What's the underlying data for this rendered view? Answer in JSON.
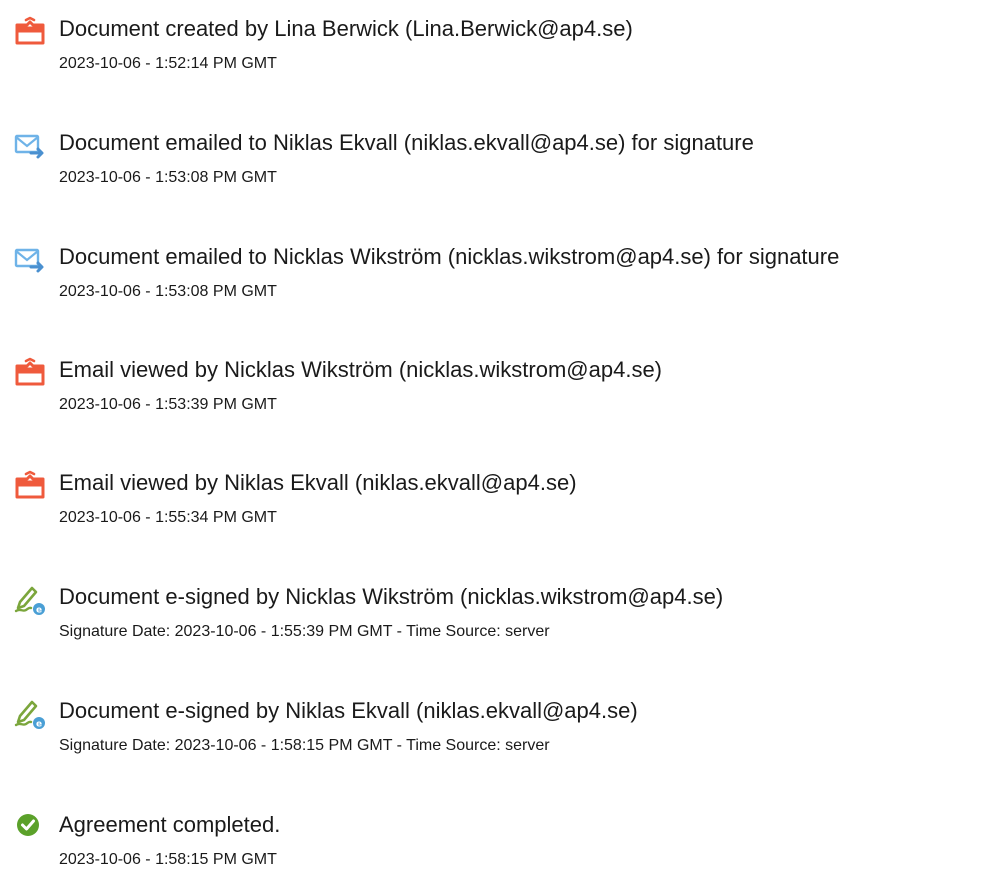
{
  "colors": {
    "pdf_icon": "#ef5a3c",
    "email_icon": "#6fb3e8",
    "esign_icon": "#7ba63c",
    "esign_badge": "#4a9fd5",
    "complete_icon": "#5ba12a",
    "text": "#1a1a1a"
  },
  "events": [
    {
      "icon": "document-created-icon",
      "title": "Document created by Lina Berwick (Lina.Berwick@ap4.se)",
      "meta": "2023-10-06 - 1:52:14 PM GMT"
    },
    {
      "icon": "email-sent-icon",
      "title": "Document emailed to Niklas Ekvall (niklas.ekvall@ap4.se) for signature",
      "meta": "2023-10-06 - 1:53:08 PM GMT"
    },
    {
      "icon": "email-sent-icon",
      "title": "Document emailed to Nicklas Wikström (nicklas.wikstrom@ap4.se) for signature",
      "meta": "2023-10-06 - 1:53:08 PM GMT"
    },
    {
      "icon": "document-viewed-icon",
      "title": "Email viewed by Nicklas Wikström (nicklas.wikstrom@ap4.se)",
      "meta": "2023-10-06 - 1:53:39 PM GMT"
    },
    {
      "icon": "document-viewed-icon",
      "title": "Email viewed by Niklas Ekvall (niklas.ekvall@ap4.se)",
      "meta": "2023-10-06 - 1:55:34 PM GMT"
    },
    {
      "icon": "esign-pen-icon",
      "title": "Document e-signed by Nicklas Wikström (nicklas.wikstrom@ap4.se)",
      "meta": "Signature Date: 2023-10-06 - 1:55:39 PM GMT - Time Source: server"
    },
    {
      "icon": "esign-pen-icon",
      "title": "Document e-signed by Niklas Ekvall (niklas.ekvall@ap4.se)",
      "meta": "Signature Date: 2023-10-06 - 1:58:15 PM GMT - Time Source: server"
    },
    {
      "icon": "checkmark-circle-icon",
      "title": "Agreement completed.",
      "meta": "2023-10-06 - 1:58:15 PM GMT"
    }
  ]
}
